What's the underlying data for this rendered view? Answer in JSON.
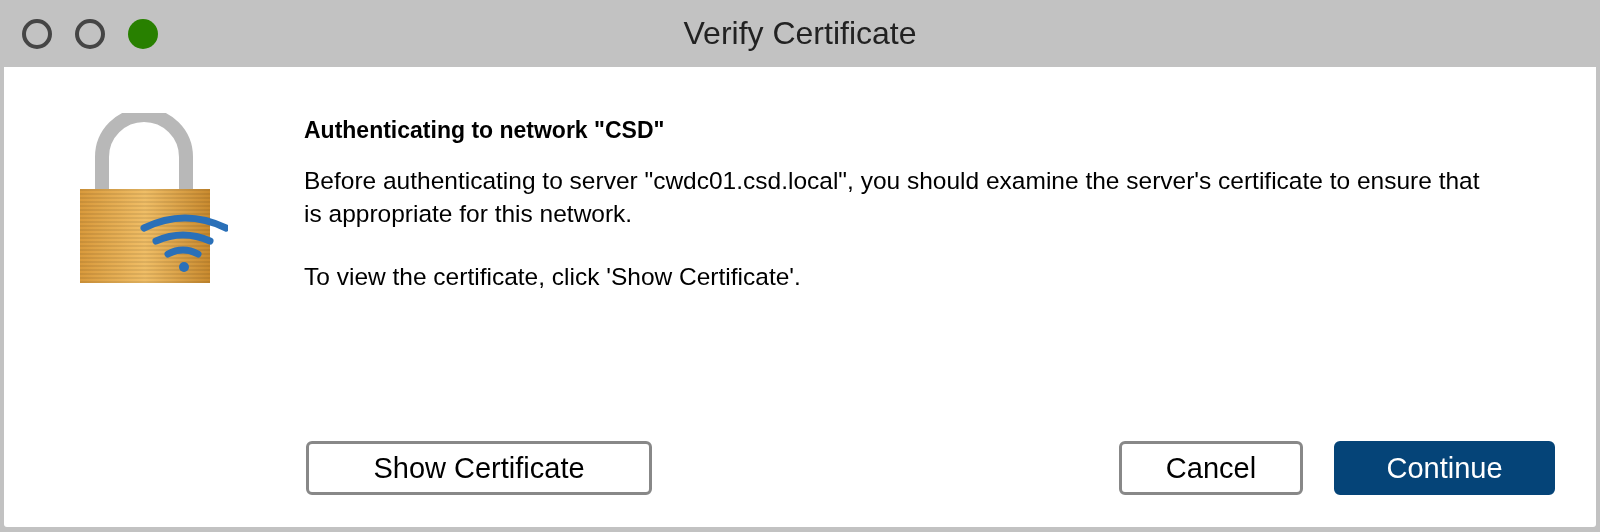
{
  "window": {
    "title": "Verify Certificate",
    "controls": [
      {
        "filled": false
      },
      {
        "filled": false
      },
      {
        "filled": true
      }
    ]
  },
  "dialog": {
    "heading": "Authenticating to network \"CSD\"",
    "paragraphs": [
      "Before authenticating to server \"cwdc01.csd.local\", you should examine the server's certificate to ensure that is appropriate for this network.",
      "To view the certificate, click 'Show Certificate'."
    ]
  },
  "left_buttons": [
    {
      "label": "Show Certificate",
      "default": false
    }
  ],
  "right_buttons": [
    {
      "label": "Cancel",
      "default": false
    },
    {
      "label": "Continue",
      "default": true
    }
  ]
}
